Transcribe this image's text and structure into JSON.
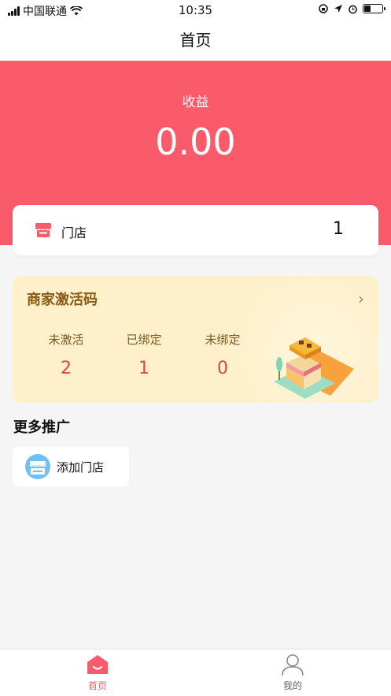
{
  "status_bar": {
    "carrier": "中国联通",
    "time": "10:35",
    "icons": [
      "signal-icon",
      "wifi-icon",
      "orientation-lock-icon",
      "location-icon",
      "alarm-icon",
      "battery-icon"
    ],
    "battery_level": 0.35
  },
  "header": {
    "title": "首页"
  },
  "earnings": {
    "label": "收益",
    "value": "0.00"
  },
  "store_summary": {
    "label": "门店",
    "count": "1",
    "icon": "store-icon"
  },
  "activation": {
    "title": "商家激活码",
    "stats": [
      {
        "label": "未激活",
        "value": "2"
      },
      {
        "label": "已绑定",
        "value": "1"
      },
      {
        "label": "未绑定",
        "value": "0"
      }
    ]
  },
  "more": {
    "title": "更多推广",
    "items": [
      {
        "label": "添加门店",
        "icon": "add-store-icon"
      }
    ]
  },
  "tabs": [
    {
      "label": "首页",
      "icon": "home-icon",
      "active": true
    },
    {
      "label": "我的",
      "icon": "user-icon",
      "active": false
    }
  ],
  "colors": {
    "primary": "#f95b6b",
    "card_bg": "#fdf0cb",
    "title_brown": "#8a5a12",
    "stat_red": "#e0443e"
  }
}
